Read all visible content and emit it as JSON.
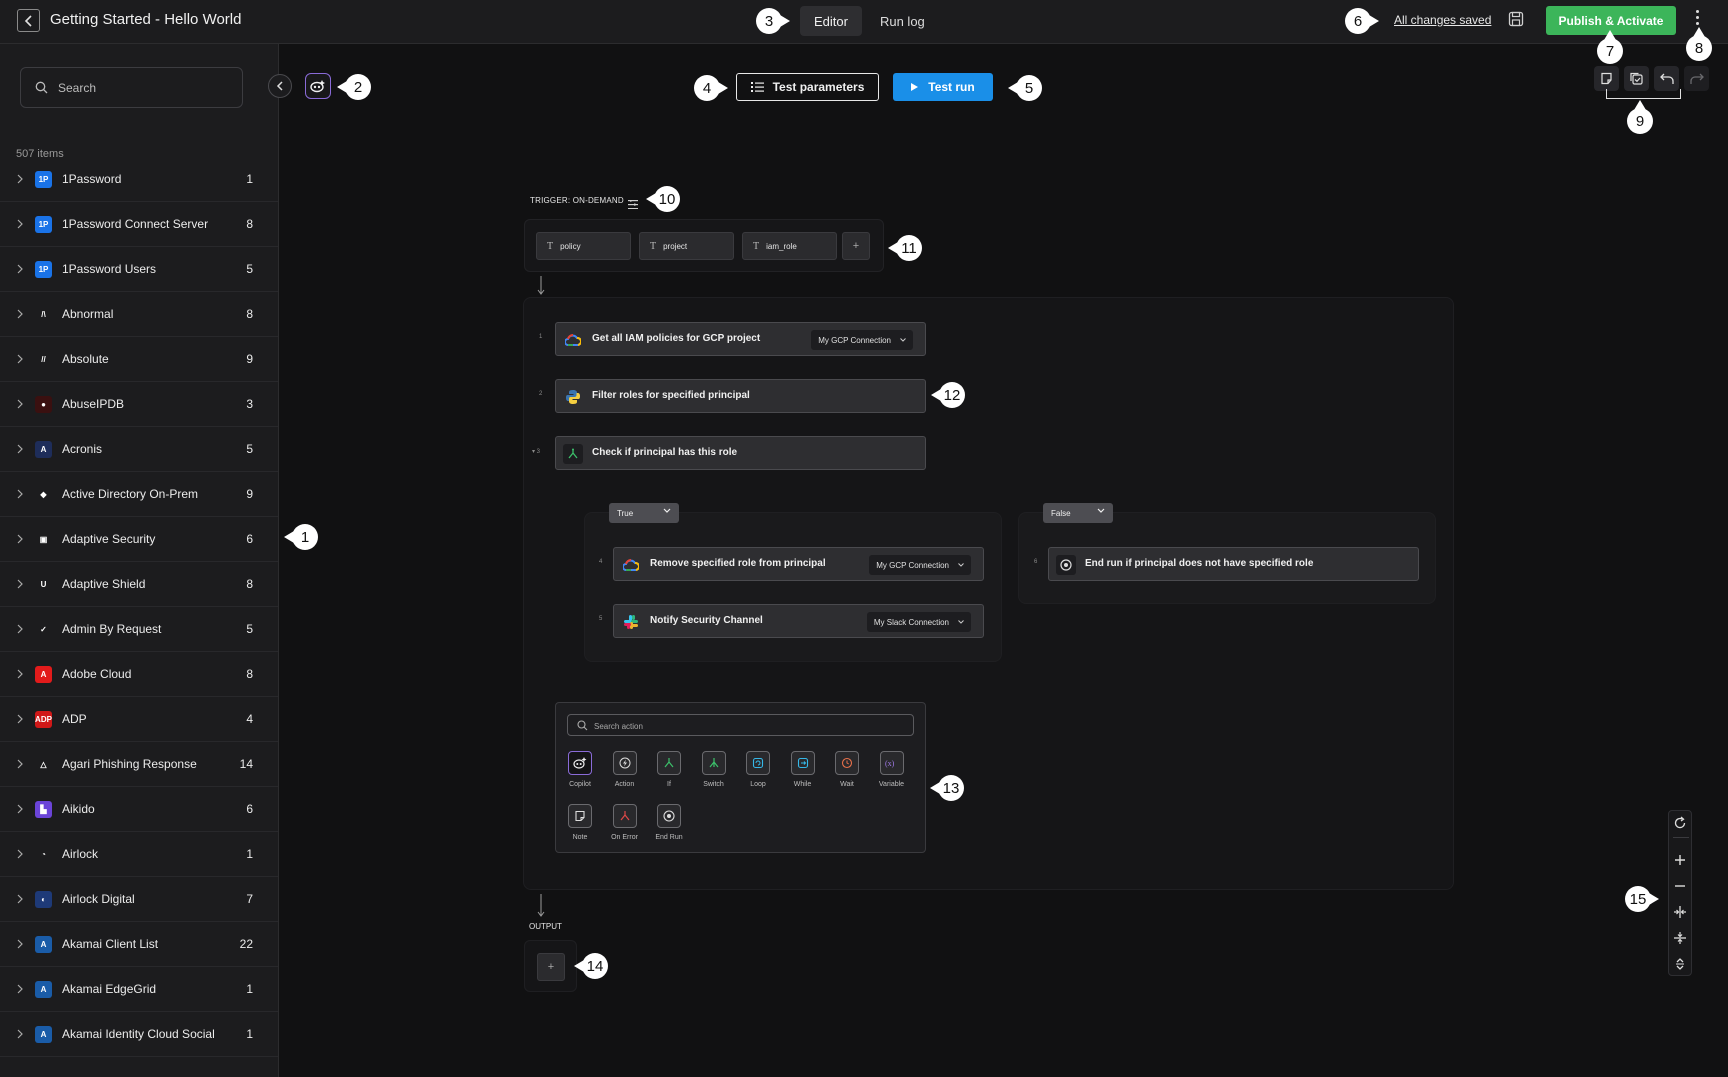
{
  "header": {
    "title": "Getting Started - Hello World",
    "tabs": [
      "Editor",
      "Run log"
    ],
    "active_tab": "Editor",
    "save_status": "All changes saved",
    "publish_label": "Publish & Activate",
    "publish_color": "#3cb55a"
  },
  "sidebar": {
    "search_placeholder": "Search",
    "count_label": "507 items",
    "items": [
      {
        "name": "1Password",
        "count": "1",
        "icon": "1password-logo",
        "color": "#1a73e8",
        "glyph": "1P"
      },
      {
        "name": "1Password Connect Server",
        "count": "8",
        "icon": "1password-logo",
        "color": "#1a73e8",
        "glyph": "1P"
      },
      {
        "name": "1Password Users",
        "count": "5",
        "icon": "1password-logo",
        "color": "#1a73e8",
        "glyph": "1P"
      },
      {
        "name": "Abnormal",
        "count": "8",
        "icon": "abnormal-logo",
        "color": "#1c1c1e",
        "glyph": "/\\"
      },
      {
        "name": "Absolute",
        "count": "9",
        "icon": "absolute-logo",
        "color": "#1c1c1e",
        "glyph": "//"
      },
      {
        "name": "AbuseIPDB",
        "count": "3",
        "icon": "abuseipdb-logo",
        "color": "#3a1010",
        "glyph": "●"
      },
      {
        "name": "Acronis",
        "count": "5",
        "icon": "acronis-logo",
        "color": "#1e2d5a",
        "glyph": "A"
      },
      {
        "name": "Active Directory On-Prem",
        "count": "9",
        "icon": "active-directory-logo",
        "color": "#1c1c1e",
        "glyph": "◆"
      },
      {
        "name": "Adaptive Security",
        "count": "6",
        "icon": "adaptive-security-logo",
        "color": "#1c1c1e",
        "glyph": "▣"
      },
      {
        "name": "Adaptive Shield",
        "count": "8",
        "icon": "adaptive-shield-logo",
        "color": "#1c1c1e",
        "glyph": "U"
      },
      {
        "name": "Admin By Request",
        "count": "5",
        "icon": "admin-by-request-logo",
        "color": "#1c1c1e",
        "glyph": "✓"
      },
      {
        "name": "Adobe Cloud",
        "count": "8",
        "icon": "adobe-logo",
        "color": "#e21b1b",
        "glyph": "A"
      },
      {
        "name": "ADP",
        "count": "4",
        "icon": "adp-logo",
        "color": "#d01818",
        "glyph": "ADP"
      },
      {
        "name": "Agari Phishing Response",
        "count": "14",
        "icon": "agari-logo",
        "color": "#1c1c1e",
        "glyph": "△"
      },
      {
        "name": "Aikido",
        "count": "6",
        "icon": "aikido-logo",
        "color": "#6b44d8",
        "glyph": "▙"
      },
      {
        "name": "Airlock",
        "count": "1",
        "icon": "airlock-logo",
        "color": "#1c1c1e",
        "glyph": "◔"
      },
      {
        "name": "Airlock Digital",
        "count": "7",
        "icon": "airlock-digital-logo",
        "color": "#1e3a78",
        "glyph": "◐"
      },
      {
        "name": "Akamai Client List",
        "count": "22",
        "icon": "akamai-logo",
        "color": "#1a5ca8",
        "glyph": "A"
      },
      {
        "name": "Akamai EdgeGrid",
        "count": "1",
        "icon": "akamai-logo",
        "color": "#1a5ca8",
        "glyph": "A"
      },
      {
        "name": "Akamai Identity Cloud Social",
        "count": "1",
        "icon": "akamai-logo",
        "color": "#1a5ca8",
        "glyph": "A"
      }
    ]
  },
  "toolbar": {
    "test_parameters": "Test parameters",
    "test_run": "Test run",
    "test_run_color": "#1a8fe8"
  },
  "workflow": {
    "trigger_label": "TRIGGER: ON-DEMAND",
    "parameters": [
      "policy",
      "project",
      "iam_role"
    ],
    "add_param": "+",
    "steps": [
      {
        "num": "1",
        "label": "Get all IAM policies for GCP project",
        "connection": "My GCP Connection",
        "icon": "google-cloud-icon"
      },
      {
        "num": "2",
        "label": "Filter roles for specified principal",
        "connection": "",
        "icon": "python-icon"
      },
      {
        "num": "▾ 3",
        "label": "Check if principal has this role",
        "connection": "",
        "icon": "if-branch-icon"
      },
      {
        "num": "4",
        "label": "Remove specified role from principal",
        "connection": "My GCP Connection",
        "icon": "google-cloud-icon"
      },
      {
        "num": "5",
        "label": "Notify Security Channel",
        "connection": "My Slack Connection",
        "icon": "slack-icon"
      },
      {
        "num": "6",
        "label": "End run if principal does not have specified role",
        "connection": "",
        "icon": "end-run-icon"
      }
    ],
    "branch_true": "True",
    "branch_false": "False",
    "output_label": "OUTPUT",
    "output_add": "+"
  },
  "action_picker": {
    "search_placeholder": "Search action",
    "items": [
      {
        "label": "Copilot",
        "icon": "copilot-icon"
      },
      {
        "label": "Action",
        "icon": "lightning-icon"
      },
      {
        "label": "If",
        "icon": "if-branch-icon"
      },
      {
        "label": "Switch",
        "icon": "switch-icon"
      },
      {
        "label": "Loop",
        "icon": "loop-icon"
      },
      {
        "label": "While",
        "icon": "while-icon"
      },
      {
        "label": "Wait",
        "icon": "wait-icon"
      },
      {
        "label": "Variable",
        "icon": "variable-icon"
      },
      {
        "label": "Note",
        "icon": "note-icon"
      },
      {
        "label": "On Error",
        "icon": "on-error-icon"
      },
      {
        "label": "End Run",
        "icon": "end-run-icon"
      }
    ]
  },
  "callouts": [
    "1",
    "2",
    "3",
    "4",
    "5",
    "6",
    "7",
    "8",
    "9",
    "10",
    "11",
    "12",
    "13",
    "14",
    "15"
  ]
}
